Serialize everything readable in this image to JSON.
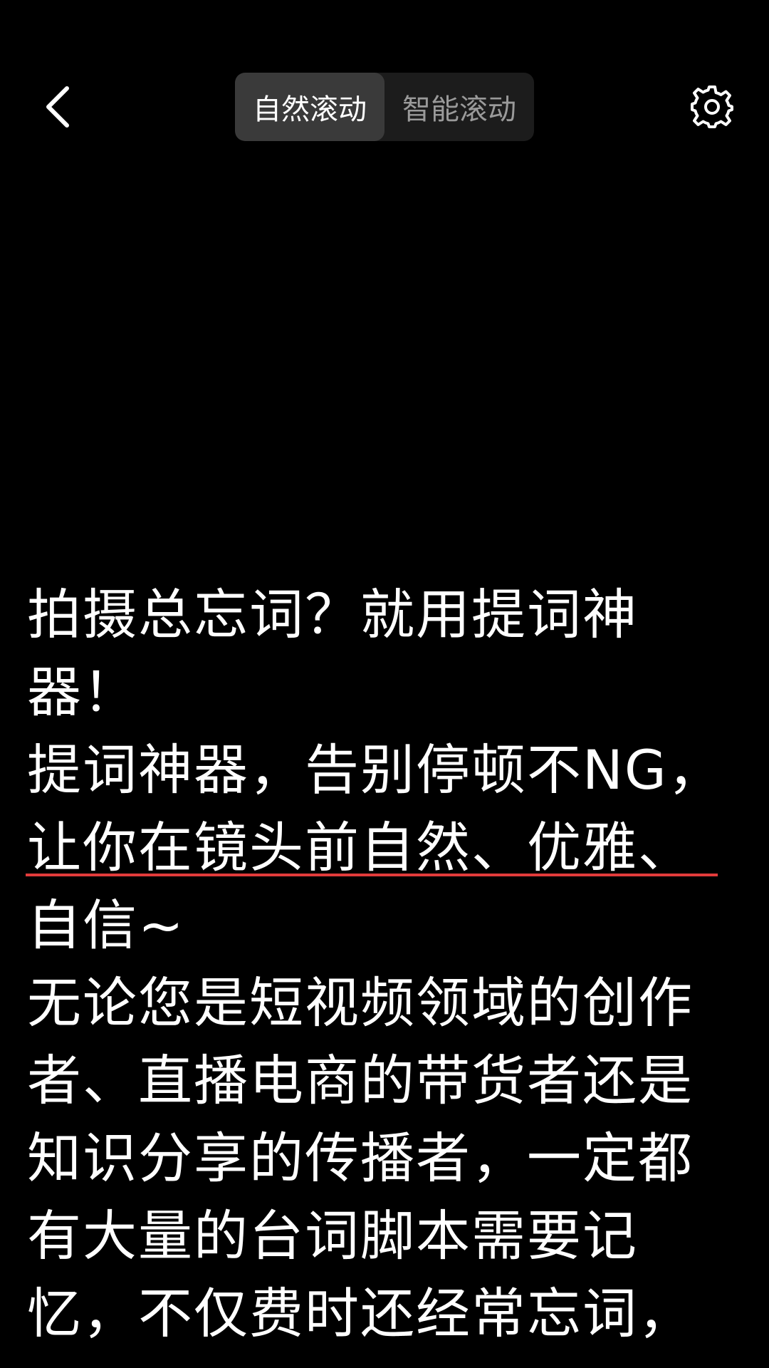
{
  "header": {
    "tabs": [
      {
        "label": "自然滚动",
        "active": true
      },
      {
        "label": "智能滚动",
        "active": false
      }
    ],
    "back_icon": "chevron-left-icon",
    "settings_icon": "gear-icon"
  },
  "script": {
    "paragraphs": [
      "拍摄总忘词？就用提词神器！",
      "提词神器，告别停顿不NG，让你在镜头前自然、优雅、自信~",
      "无论您是短视频领域的创作者、直播电商的带货者还是知识分享的传播者，一定都有大量的台词脚本需要记忆，不仅费时还经常忘词，"
    ]
  },
  "colors": {
    "background": "#000000",
    "text": "#ffffff",
    "reading_line": "#e23b3b",
    "segment_bg": "#1c1c1c",
    "segment_active_bg": "#3a3a3a",
    "segment_inactive_text": "#9a9a9a"
  }
}
